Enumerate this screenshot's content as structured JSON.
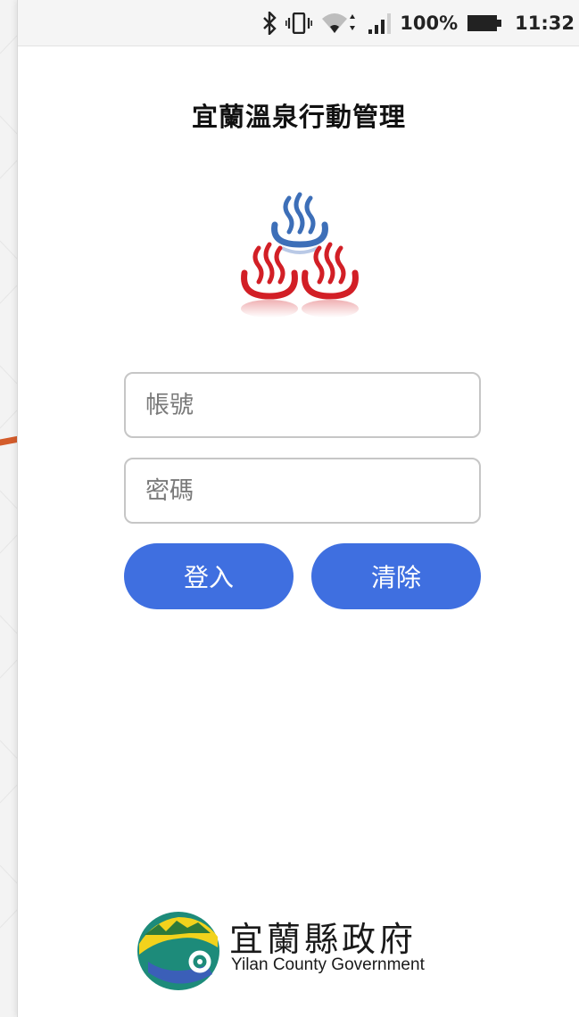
{
  "status_bar": {
    "battery": "100%",
    "time": "11:32",
    "icons": [
      "bluetooth-icon",
      "vibrate-icon",
      "wifi-icon",
      "signal-icon",
      "battery-icon"
    ]
  },
  "app": {
    "title": "宜蘭溫泉行動管理",
    "logo_icon": "hot-spring-icon"
  },
  "login": {
    "account_placeholder": "帳號",
    "password_placeholder": "密碼",
    "login_label": "登入",
    "clear_label": "清除"
  },
  "footer": {
    "org_name": "宜蘭縣政府",
    "org_name_en": "Yilan County Government"
  },
  "colors": {
    "button": "#3f6fe0",
    "steam_blue": "#3d6fb8",
    "steam_red": "#d21f26",
    "annotation_arrow": "#d35c2b"
  }
}
